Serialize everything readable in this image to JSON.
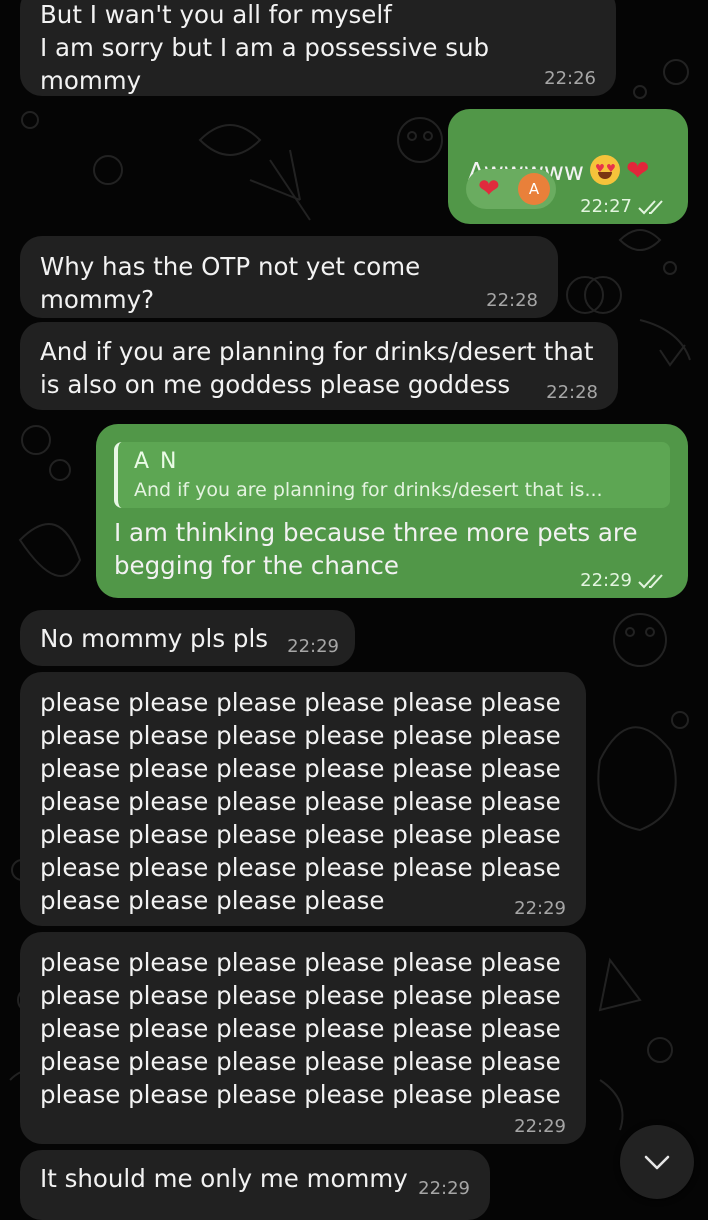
{
  "messages": [
    {
      "id": "m1",
      "direction": "incoming",
      "text": "But I wan't you all for myself\nI am sorry but I am a possessive sub mommy",
      "time": "22:26"
    },
    {
      "id": "m2",
      "direction": "outgoing",
      "text": "Awwwww",
      "emojis": [
        "heart-eyes-emoji",
        "red-heart-emoji"
      ],
      "reaction": {
        "emoji": "red-heart",
        "avatar_letter": "A"
      },
      "time": "22:27",
      "status": "read"
    },
    {
      "id": "m3",
      "direction": "incoming",
      "text": "Why has the OTP not yet come mommy?",
      "time": "22:28"
    },
    {
      "id": "m4",
      "direction": "incoming",
      "text": "And if you are planning for drinks/desert that\nis also on me goddess please goddess",
      "time": "22:28"
    },
    {
      "id": "m5",
      "direction": "outgoing",
      "reply_to": {
        "name": "A N",
        "text": "And if you are planning for drinks/desert that is..."
      },
      "text": "I am thinking because three more pets are\nbegging for the chance",
      "time": "22:29",
      "status": "read"
    },
    {
      "id": "m6",
      "direction": "incoming",
      "text": "No mommy pls pls",
      "time": "22:29"
    },
    {
      "id": "m7",
      "direction": "incoming",
      "text": "please please please please please please\nplease please please please please please\nplease please please please please please\nplease please please please please please\nplease please please please please please\nplease please please please please please\nplease please please please",
      "time": "22:29"
    },
    {
      "id": "m8",
      "direction": "incoming",
      "text": "please please please please please please\nplease please please please please please\nplease please please please please please\nplease please please please please please\nplease please please please please please",
      "time": "22:29"
    },
    {
      "id": "m9",
      "direction": "incoming",
      "text": "It should me only me mommy",
      "time": "22:29"
    }
  ],
  "scroll_button_icon": "chevron-down-icon",
  "colors": {
    "background": "#050505",
    "incoming_bubble": "#212121",
    "outgoing_bubble": "#519748",
    "doodle": "#1f1f1f"
  }
}
